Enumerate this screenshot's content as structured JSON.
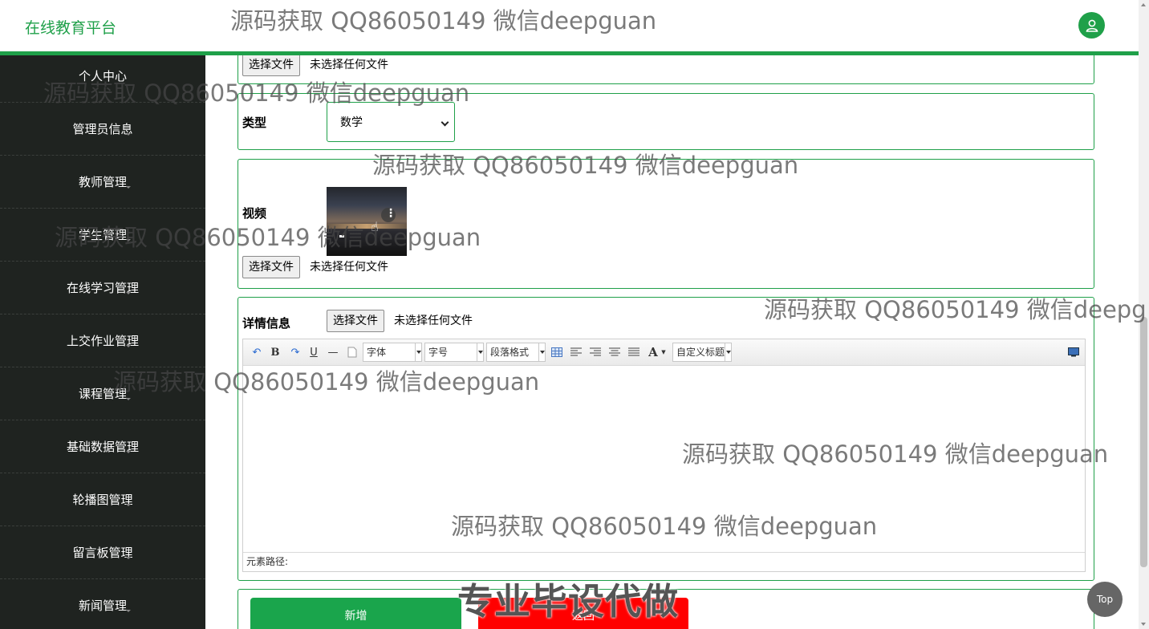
{
  "header": {
    "brand": "在线教育平台"
  },
  "sidebar": {
    "items": [
      {
        "label": "个人中心"
      },
      {
        "label": "管理员信息"
      },
      {
        "label": "教师管理"
      },
      {
        "label": "学生管理"
      },
      {
        "label": "在线学习管理"
      },
      {
        "label": "上交作业管理"
      },
      {
        "label": "课程管理"
      },
      {
        "label": "基础数据管理"
      },
      {
        "label": "轮播图管理"
      },
      {
        "label": "留言板管理"
      },
      {
        "label": "新闻管理"
      }
    ]
  },
  "form": {
    "file_button": "选择文件",
    "no_file": "未选择任何文件",
    "type_label": "类型",
    "type_value": "数学",
    "video_label": "视频",
    "detail_label": "详情信息"
  },
  "editor": {
    "toolbar": {
      "font": "字体",
      "size": "字号",
      "paragraph": "段落格式",
      "custom_title": "自定义标题",
      "bold": "B",
      "underline": "U",
      "font_color": "A"
    },
    "status": "元素路径:"
  },
  "buttons": {
    "add": "新增",
    "back": "返回"
  },
  "top_button": "Top",
  "watermark": {
    "text": "源码获取 QQ86050149 微信deepguan",
    "partial": "源码获取 QQ86050149 微信deepg",
    "banner": "专业毕设代做"
  },
  "colors": {
    "accent": "#1fa049",
    "sidebar": "#1f2320",
    "danger": "#ff0000"
  }
}
